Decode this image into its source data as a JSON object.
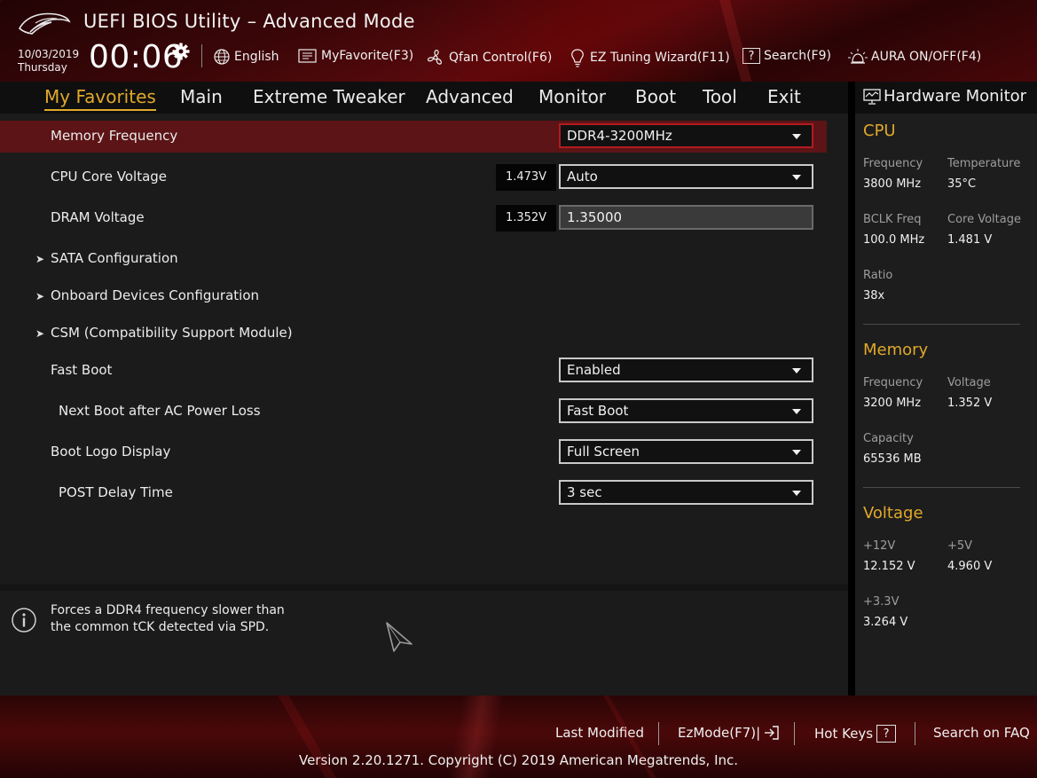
{
  "app": {
    "title": "UEFI BIOS Utility – Advanced Mode"
  },
  "header": {
    "date": "10/03/2019",
    "day": "Thursday",
    "time": "00:06",
    "items": {
      "language": "English",
      "myfavorite": "MyFavorite(F3)",
      "qfan": "Qfan Control(F6)",
      "ez_tuning": "EZ Tuning Wizard(F11)",
      "search": "Search(F9)",
      "aura": "AURA ON/OFF(F4)"
    }
  },
  "tabs": [
    "My Favorites",
    "Main",
    "Extreme Tweaker",
    "Advanced",
    "Monitor",
    "Boot",
    "Tool",
    "Exit"
  ],
  "settings": {
    "memory_frequency": {
      "label": "Memory Frequency",
      "value": "DDR4-3200MHz"
    },
    "cpu_core_voltage": {
      "label": "CPU Core Voltage",
      "reading": "1.473V",
      "value": "Auto"
    },
    "dram_voltage": {
      "label": "DRAM Voltage",
      "reading": "1.352V",
      "value": "1.35000"
    },
    "sata_configuration": {
      "label": "SATA Configuration"
    },
    "onboard_devices": {
      "label": "Onboard Devices Configuration"
    },
    "csm": {
      "label": "CSM (Compatibility Support Module)"
    },
    "fast_boot": {
      "label": "Fast Boot",
      "value": "Enabled"
    },
    "next_boot_ac": {
      "label": "Next Boot after AC Power Loss",
      "value": "Fast Boot"
    },
    "boot_logo": {
      "label": "Boot Logo Display",
      "value": "Full Screen"
    },
    "post_delay": {
      "label": "POST Delay Time",
      "value": "3 sec"
    }
  },
  "help": {
    "line1": "Forces a DDR4 frequency slower than",
    "line2": "the common tCK detected via SPD."
  },
  "hardware_monitor": {
    "title": "Hardware Monitor",
    "cpu": {
      "section": "CPU",
      "frequency_label": "Frequency",
      "frequency": "3800 MHz",
      "temperature_label": "Temperature",
      "temperature": "35°C",
      "bclk_label": "BCLK Freq",
      "bclk": "100.0 MHz",
      "core_voltage_label": "Core Voltage",
      "core_voltage": "1.481 V",
      "ratio_label": "Ratio",
      "ratio": "38x"
    },
    "memory": {
      "section": "Memory",
      "frequency_label": "Frequency",
      "frequency": "3200 MHz",
      "voltage_label": "Voltage",
      "voltage": "1.352 V",
      "capacity_label": "Capacity",
      "capacity": "65536 MB"
    },
    "voltage": {
      "section": "Voltage",
      "v12_label": "+12V",
      "v12": "12.152 V",
      "v5_label": "+5V",
      "v5": "4.960 V",
      "v33_label": "+3.3V",
      "v33": "3.264 V"
    }
  },
  "footer": {
    "last_modified": "Last Modified",
    "ezmode": "EzMode(F7)|",
    "hot_keys": "Hot Keys",
    "faq": "Search on FAQ",
    "version": "Version 2.20.1271. Copyright (C) 2019 American Megatrends, Inc."
  },
  "colors": {
    "accent": "#e0a92a",
    "highlight": "#5c1416",
    "select_border_active": "#b51a1e"
  }
}
